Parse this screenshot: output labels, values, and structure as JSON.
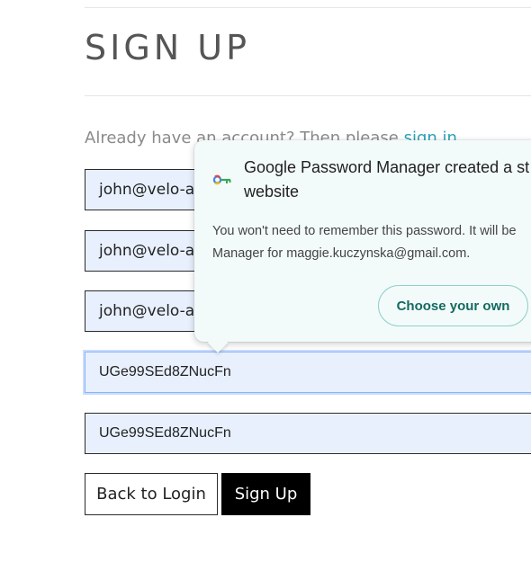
{
  "page": {
    "title": "SIGN UP",
    "already_text": "Already have an account? Then please ",
    "sign_in_link": "sign in"
  },
  "form": {
    "field1_value": "john@velo-a",
    "field2_value": "john@velo-a",
    "field3_value": "john@velo-a",
    "password_value": "UGe99SEd8ZNucFn",
    "confirm_password_value": "UGe99SEd8ZNucFn"
  },
  "buttons": {
    "back_label": "Back to Login",
    "signup_label": "Sign Up"
  },
  "password_manager": {
    "title_line1": "Google Password Manager created a st",
    "title_line2": "website",
    "body_line1": "You won't need to remember this password. It will be",
    "body_line2": "Manager for maggie.kuczynska@gmail.com.",
    "choose_own_label": "Choose your own",
    "key_icon": "key-icon"
  },
  "colors": {
    "link": "#2aa3b6",
    "autofill_bg": "#e8f0fe",
    "popup_bg": "#f3fbfa",
    "popup_button_text": "#146a62",
    "signup_button_bg": "#000000"
  }
}
